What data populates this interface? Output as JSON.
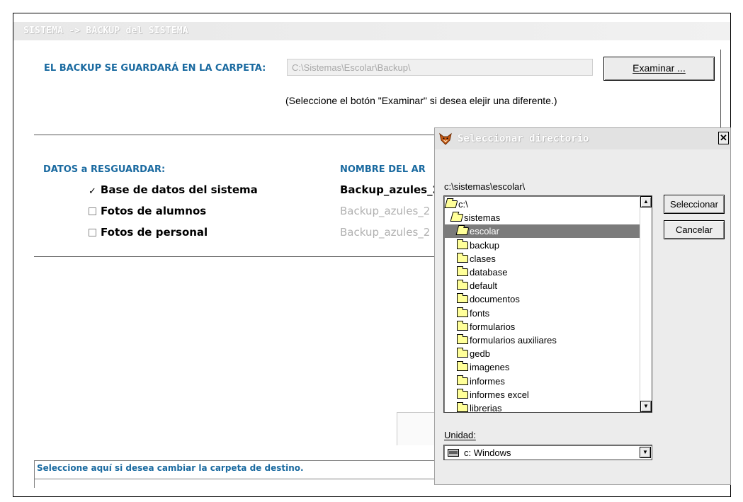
{
  "window": {
    "title": "SISTEMA -> BACKUP del SISTEMA"
  },
  "backup_folder": {
    "label": "EL BACKUP SE GUARDARÁ EN LA CARPETA:",
    "path": "C:\\Sistemas\\Escolar\\Backup\\",
    "browse_button": "Examinar ...",
    "hint": "(Seleccione el botón \"Examinar\" si desea elejir una diferente.)"
  },
  "data_section": {
    "heading": "DATOS a RESGUARDAR:",
    "filename_heading": "NOMBRE DEL AR",
    "items": [
      {
        "label": "Base de datos del sistema",
        "checked": true,
        "filename": "Backup_azules_2"
      },
      {
        "label": "Fotos de alumnos",
        "checked": false,
        "filename": "Backup_azules_2"
      },
      {
        "label": "Fotos de personal",
        "checked": false,
        "filename": "Backup_azules_2"
      }
    ]
  },
  "status": {
    "text": "Seleccione aquí si desea cambiar la carpeta de destino."
  },
  "dialog": {
    "title": "Seleccionar directorio",
    "close_label": "x",
    "current_path": "c:\\sistemas\\escolar\\",
    "tree": [
      {
        "label": "c:\\",
        "level": 0,
        "icon": "open-folder-icon"
      },
      {
        "label": "sistemas",
        "level": 1,
        "icon": "open-folder-icon"
      },
      {
        "label": "escolar",
        "level": 2,
        "icon": "open-folder-icon",
        "selected": true
      },
      {
        "label": "backup",
        "level": 3,
        "icon": "folder-icon"
      },
      {
        "label": "clases",
        "level": 3,
        "icon": "folder-icon"
      },
      {
        "label": "database",
        "level": 3,
        "icon": "folder-icon"
      },
      {
        "label": "default",
        "level": 3,
        "icon": "folder-icon"
      },
      {
        "label": "documentos",
        "level": 3,
        "icon": "folder-icon"
      },
      {
        "label": "fonts",
        "level": 3,
        "icon": "folder-icon"
      },
      {
        "label": "formularios",
        "level": 3,
        "icon": "folder-icon"
      },
      {
        "label": "formularios auxiliares",
        "level": 3,
        "icon": "folder-icon"
      },
      {
        "label": "gedb",
        "level": 3,
        "icon": "folder-icon"
      },
      {
        "label": "imagenes",
        "level": 3,
        "icon": "folder-icon"
      },
      {
        "label": "informes",
        "level": 3,
        "icon": "folder-icon"
      },
      {
        "label": "informes excel",
        "level": 3,
        "icon": "folder-icon"
      },
      {
        "label": "librerias",
        "level": 3,
        "icon": "folder-icon"
      }
    ],
    "select_button": "Seleccionar",
    "cancel_button": "Cancelar",
    "drive_label": "Unidad:",
    "drive_value": "c: Windows"
  },
  "colors": {
    "accent_blue": "#1a6aa0",
    "selection_gray": "#7b7b7b",
    "folder_yellow": "#ffff99"
  }
}
